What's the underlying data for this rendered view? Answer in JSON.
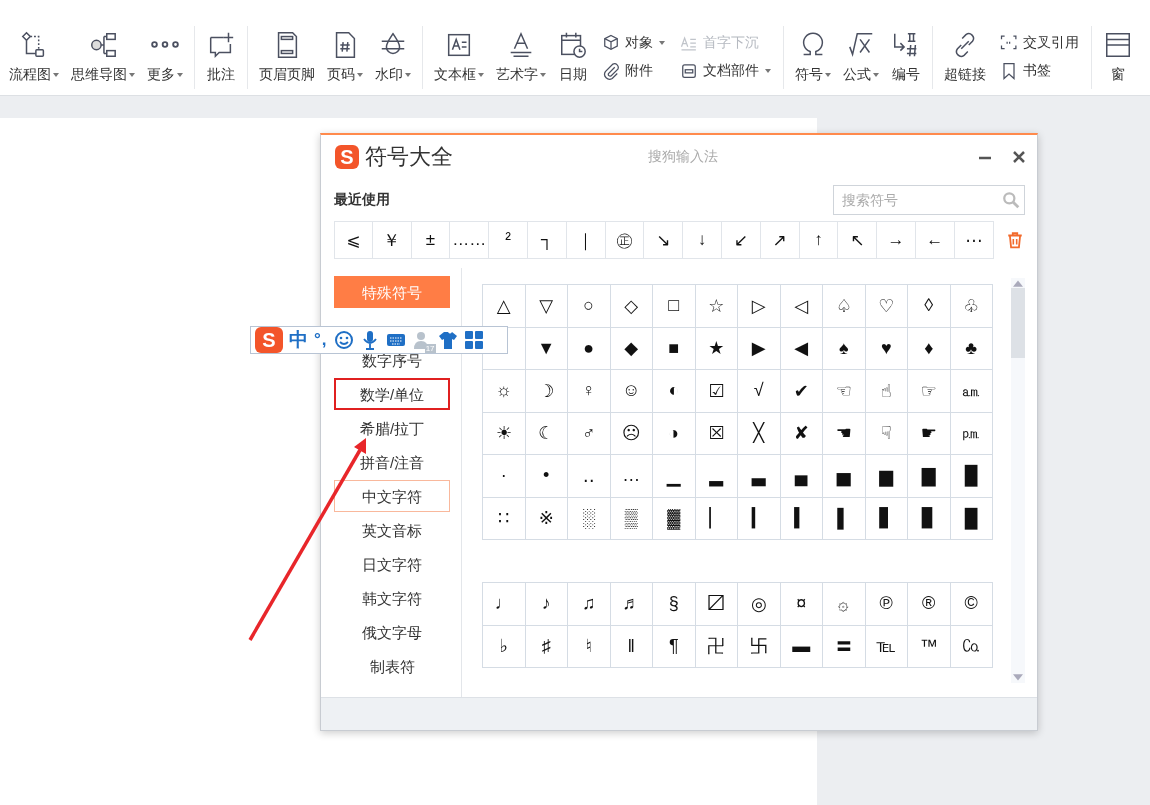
{
  "toolbar": {
    "groups": [
      {
        "items": [
          {
            "kind": "large",
            "label": "流程图",
            "dropdown": true
          },
          {
            "kind": "large",
            "label": "思维导图",
            "dropdown": true
          },
          {
            "kind": "large",
            "label": "更多",
            "dropdown": true
          }
        ]
      },
      {
        "items": [
          {
            "kind": "large",
            "label": "批注",
            "dropdown": false
          }
        ]
      },
      {
        "items": [
          {
            "kind": "large",
            "label": "页眉页脚",
            "dropdown": false
          },
          {
            "kind": "large",
            "label": "页码",
            "dropdown": true
          },
          {
            "kind": "large",
            "label": "水印",
            "dropdown": true
          }
        ]
      },
      {
        "items": [
          {
            "kind": "large",
            "label": "文本框",
            "dropdown": true
          },
          {
            "kind": "large",
            "label": "艺术字",
            "dropdown": true
          },
          {
            "kind": "large",
            "label": "日期",
            "dropdown": false
          },
          {
            "kind": "stack",
            "items": [
              {
                "label": "对象",
                "dropdown": true,
                "disabled": false
              },
              {
                "label": "附件",
                "dropdown": false,
                "disabled": false
              }
            ]
          },
          {
            "kind": "stack",
            "items": [
              {
                "label": "首字下沉",
                "dropdown": false,
                "disabled": true
              },
              {
                "label": "文档部件",
                "dropdown": true,
                "disabled": false
              }
            ]
          }
        ]
      },
      {
        "items": [
          {
            "kind": "large",
            "label": "符号",
            "dropdown": true
          },
          {
            "kind": "large",
            "label": "公式",
            "dropdown": true
          },
          {
            "kind": "large",
            "label": "编号",
            "dropdown": false
          }
        ]
      },
      {
        "items": [
          {
            "kind": "large",
            "label": "超链接",
            "dropdown": false
          },
          {
            "kind": "stack",
            "items": [
              {
                "label": "交叉引用",
                "dropdown": false,
                "disabled": false
              },
              {
                "label": "书签",
                "dropdown": false,
                "disabled": false
              }
            ]
          }
        ]
      },
      {
        "items": [
          {
            "kind": "large",
            "label": "窗",
            "dropdown": false
          }
        ]
      }
    ]
  },
  "symbol_dialog": {
    "logo": "S",
    "title": "符号大全",
    "app_name": "搜狗输入法",
    "recent_label": "最近使用",
    "search": {
      "placeholder": "搜索符号"
    },
    "recent": [
      "⩽",
      "￥",
      "±",
      "……",
      "²",
      "┐",
      "｜",
      "㊣",
      "↘",
      "↓",
      "↙",
      "↗",
      "↑",
      "↖",
      "→",
      "←",
      "⋯"
    ],
    "categories": [
      {
        "label": "特殊符号",
        "selected": true,
        "hovered": false,
        "highlighted": false
      },
      {
        "label": "数字序号",
        "selected": false,
        "hovered": false,
        "highlighted": false
      },
      {
        "label": "数学/单位",
        "selected": false,
        "hovered": false,
        "highlighted": true
      },
      {
        "label": "希腊/拉丁",
        "selected": false,
        "hovered": false,
        "highlighted": false
      },
      {
        "label": "拼音/注音",
        "selected": false,
        "hovered": false,
        "highlighted": false
      },
      {
        "label": "中文字符",
        "selected": false,
        "hovered": true,
        "highlighted": false
      },
      {
        "label": "英文音标",
        "selected": false,
        "hovered": false,
        "highlighted": false
      },
      {
        "label": "日文字符",
        "selected": false,
        "hovered": false,
        "highlighted": false
      },
      {
        "label": "韩文字符",
        "selected": false,
        "hovered": false,
        "highlighted": false
      },
      {
        "label": "俄文字母",
        "selected": false,
        "hovered": false,
        "highlighted": false
      },
      {
        "label": "制表符",
        "selected": false,
        "hovered": false,
        "highlighted": false
      }
    ],
    "grids": [
      {
        "rows": [
          [
            "△",
            "▽",
            "○",
            "◇",
            "□",
            "☆",
            "▷",
            "◁",
            "♤",
            "♡",
            "◊",
            "♧"
          ],
          [
            null,
            "▼",
            "●",
            "◆",
            "■",
            "★",
            "▶",
            "◀",
            "♠",
            "♥",
            "♦",
            "♣"
          ],
          [
            "☼",
            "☽",
            "♀",
            "☺",
            "◐",
            "☑",
            "√",
            "✔",
            "☜",
            "☝",
            "☞",
            "㏂"
          ],
          [
            "☀",
            "☾",
            "♂",
            "☹",
            "◑",
            "☒",
            "╳",
            "✘",
            "☚",
            "☟",
            "☛",
            "㏘"
          ],
          [
            "·",
            "•",
            "‥",
            "…",
            "▁",
            "▂",
            "▃",
            "▄",
            "▅",
            "▆",
            "▇",
            "█"
          ],
          [
            "∷",
            "※",
            "░",
            "▒",
            "▓",
            "▏",
            "▎",
            "▍",
            "▌",
            "▋",
            "▊",
            "█"
          ]
        ]
      },
      {
        "rows": [
          [
            "♩",
            "♪",
            "♫",
            "♬",
            "§",
            "〼",
            "◎",
            "¤",
            "۞",
            "℗",
            "®",
            "©"
          ],
          [
            "♭",
            "♯",
            "♮",
            "‖",
            "¶",
            "卍",
            "卐",
            "▬",
            "〓",
            "℡",
            "™",
            "㏇"
          ]
        ]
      }
    ]
  },
  "ime_bar": {
    "logo": "S",
    "mode": "中",
    "punctuation": "°,",
    "badge": "17"
  }
}
